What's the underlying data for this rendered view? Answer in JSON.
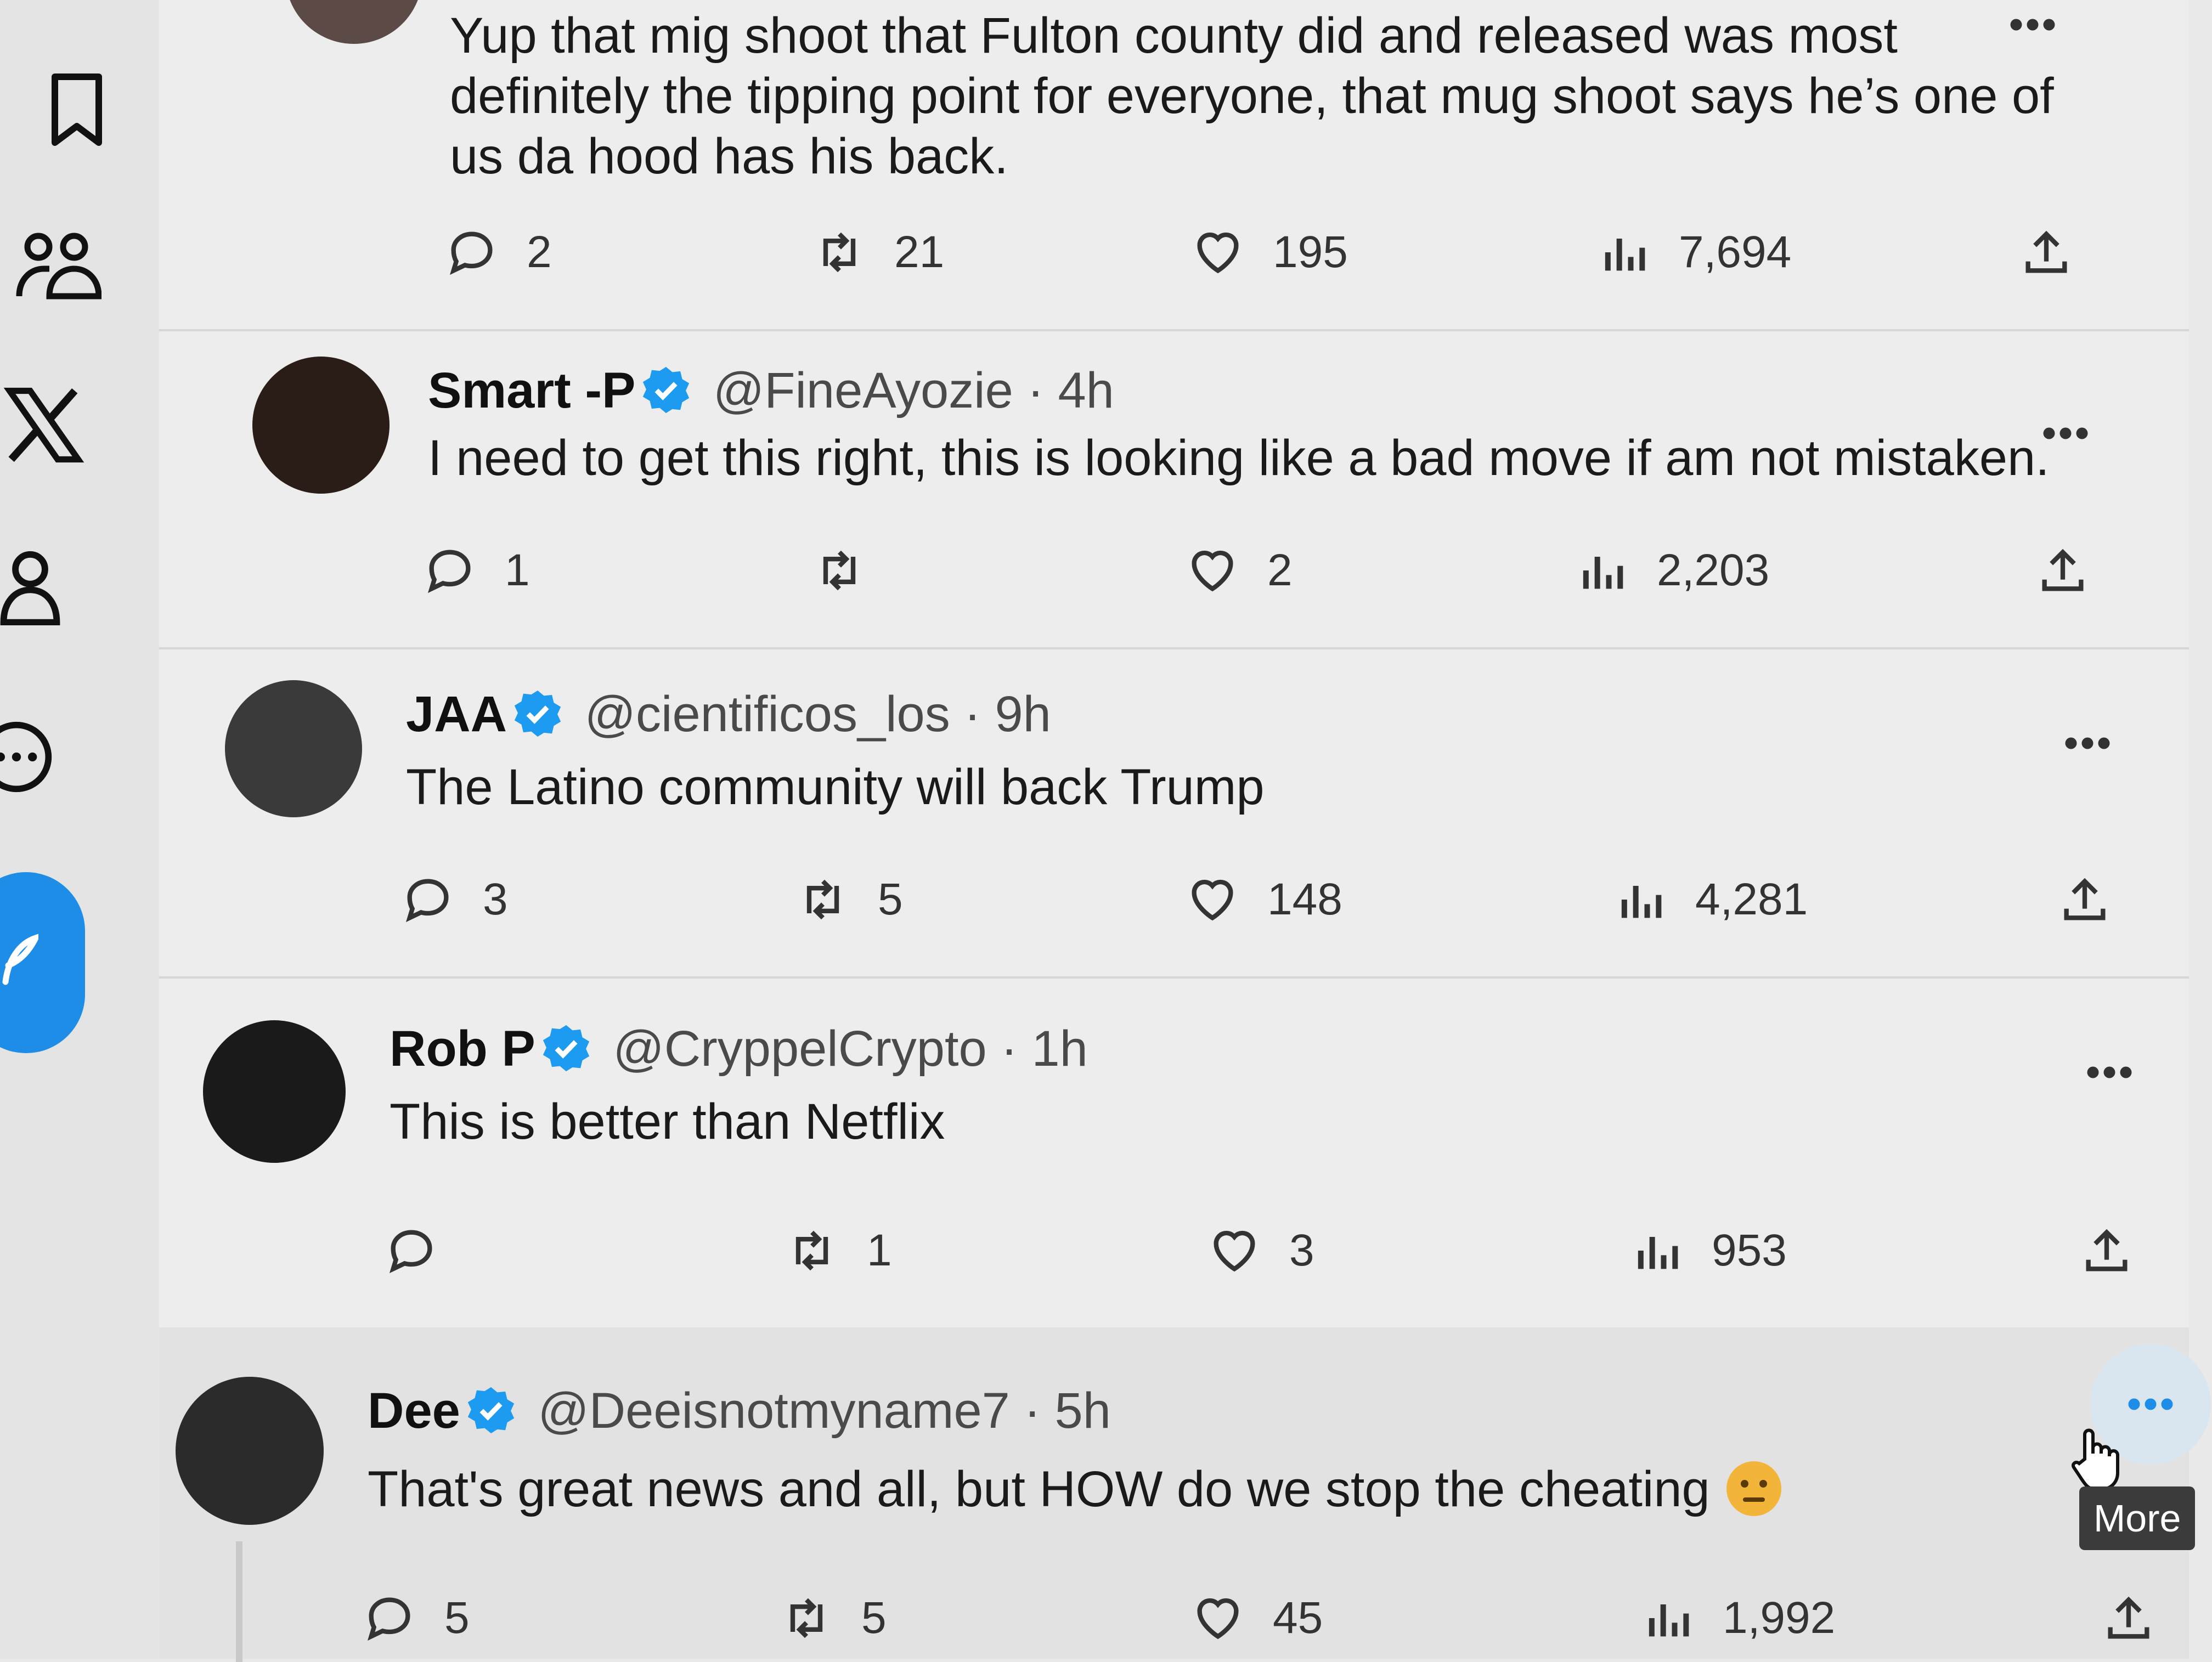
{
  "nav": {
    "items": [
      {
        "id": "bookmarks",
        "icon": "bookmark-icon"
      },
      {
        "id": "communities",
        "icon": "people-icon"
      },
      {
        "id": "premium",
        "icon": "x-logo-icon"
      },
      {
        "id": "profile",
        "icon": "person-icon"
      },
      {
        "id": "more",
        "icon": "more-circle-icon"
      }
    ],
    "post_button_icon": "feather-icon",
    "accent_color": "#1d8de8"
  },
  "tweets": [
    {
      "name": "",
      "handle": "",
      "time": "",
      "text": "Yup that mig shoot that Fulton county did and released was most definitely the tipping point for everyone, that mug shoot says he’s one of us da hood has his back.",
      "replies": "2",
      "reposts": "21",
      "likes": "195",
      "views": "7,694"
    },
    {
      "name": "Smart -P",
      "handle": "@FineAyozie",
      "sep": "·",
      "time": "4h",
      "text": "I need to get this right, this is looking like a bad move if am not mistaken.",
      "replies": "1",
      "reposts": "",
      "likes": "2",
      "views": "2,203"
    },
    {
      "name": "JAA",
      "handle": "@cientificos_los",
      "sep": "·",
      "time": "9h",
      "text": "The Latino community will back Trump",
      "replies": "3",
      "reposts": "5",
      "likes": "148",
      "views": "4,281"
    },
    {
      "name": "Rob P",
      "handle": "@CryppelCrypto",
      "sep": "·",
      "time": "1h",
      "text": "This is better than Netflix",
      "replies": "",
      "reposts": "1",
      "likes": "3",
      "views": "953"
    },
    {
      "name": "Dee",
      "handle": "@Deeisnotmyname7",
      "sep": "·",
      "time": "5h",
      "text": "That's great news and all, but HOW do we stop the cheating",
      "emoji": "thinking-face-emoji",
      "replies": "5",
      "reposts": "5",
      "likes": "45",
      "views": "1,992"
    }
  ],
  "tooltip": {
    "label": "More"
  },
  "colors": {
    "verified": "#1d9bf0",
    "hover_bg": "#d9e6f0"
  }
}
